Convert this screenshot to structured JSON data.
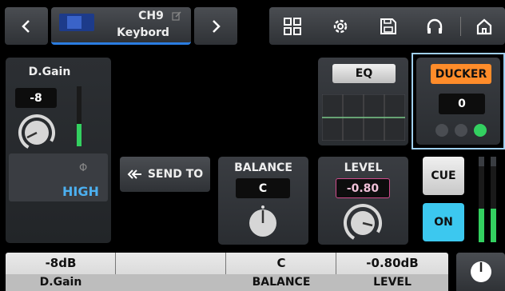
{
  "header": {
    "channel_id": "CH9",
    "channel_name": "Keybord",
    "prev_icon": "chevron-left-icon",
    "next_icon": "chevron-right-icon",
    "tools": [
      "grid-icon",
      "gear-icon",
      "save-icon",
      "headphones-icon",
      "home-icon"
    ]
  },
  "dgain": {
    "title": "D.Gain",
    "value": "-8",
    "phantom_symbol": "Φ",
    "range": "HIGH"
  },
  "send_to": {
    "label": "SEND TO"
  },
  "eq": {
    "label": "EQ"
  },
  "ducker": {
    "label": "DUCKER",
    "value": "0",
    "indicator_lit": 2
  },
  "balance": {
    "title": "BALANCE",
    "value": "C"
  },
  "level": {
    "title": "LEVEL",
    "value": "-0.80"
  },
  "cue": {
    "label": "CUE"
  },
  "on": {
    "label": "ON"
  },
  "bottom_bar": {
    "cells": [
      {
        "value": "-8dB",
        "label": "D.Gain"
      },
      {
        "value": "",
        "label": ""
      },
      {
        "value": "C",
        "label": "BALANCE"
      },
      {
        "value": "-0.80dB",
        "label": "LEVEL"
      }
    ]
  },
  "colors": {
    "accent_blue": "#2b7de0",
    "ducker_orange": "#ff8c2a",
    "meter_green": "#33d060",
    "level_pink": "#d04b8c",
    "on_cyan": "#3cc8ef"
  }
}
